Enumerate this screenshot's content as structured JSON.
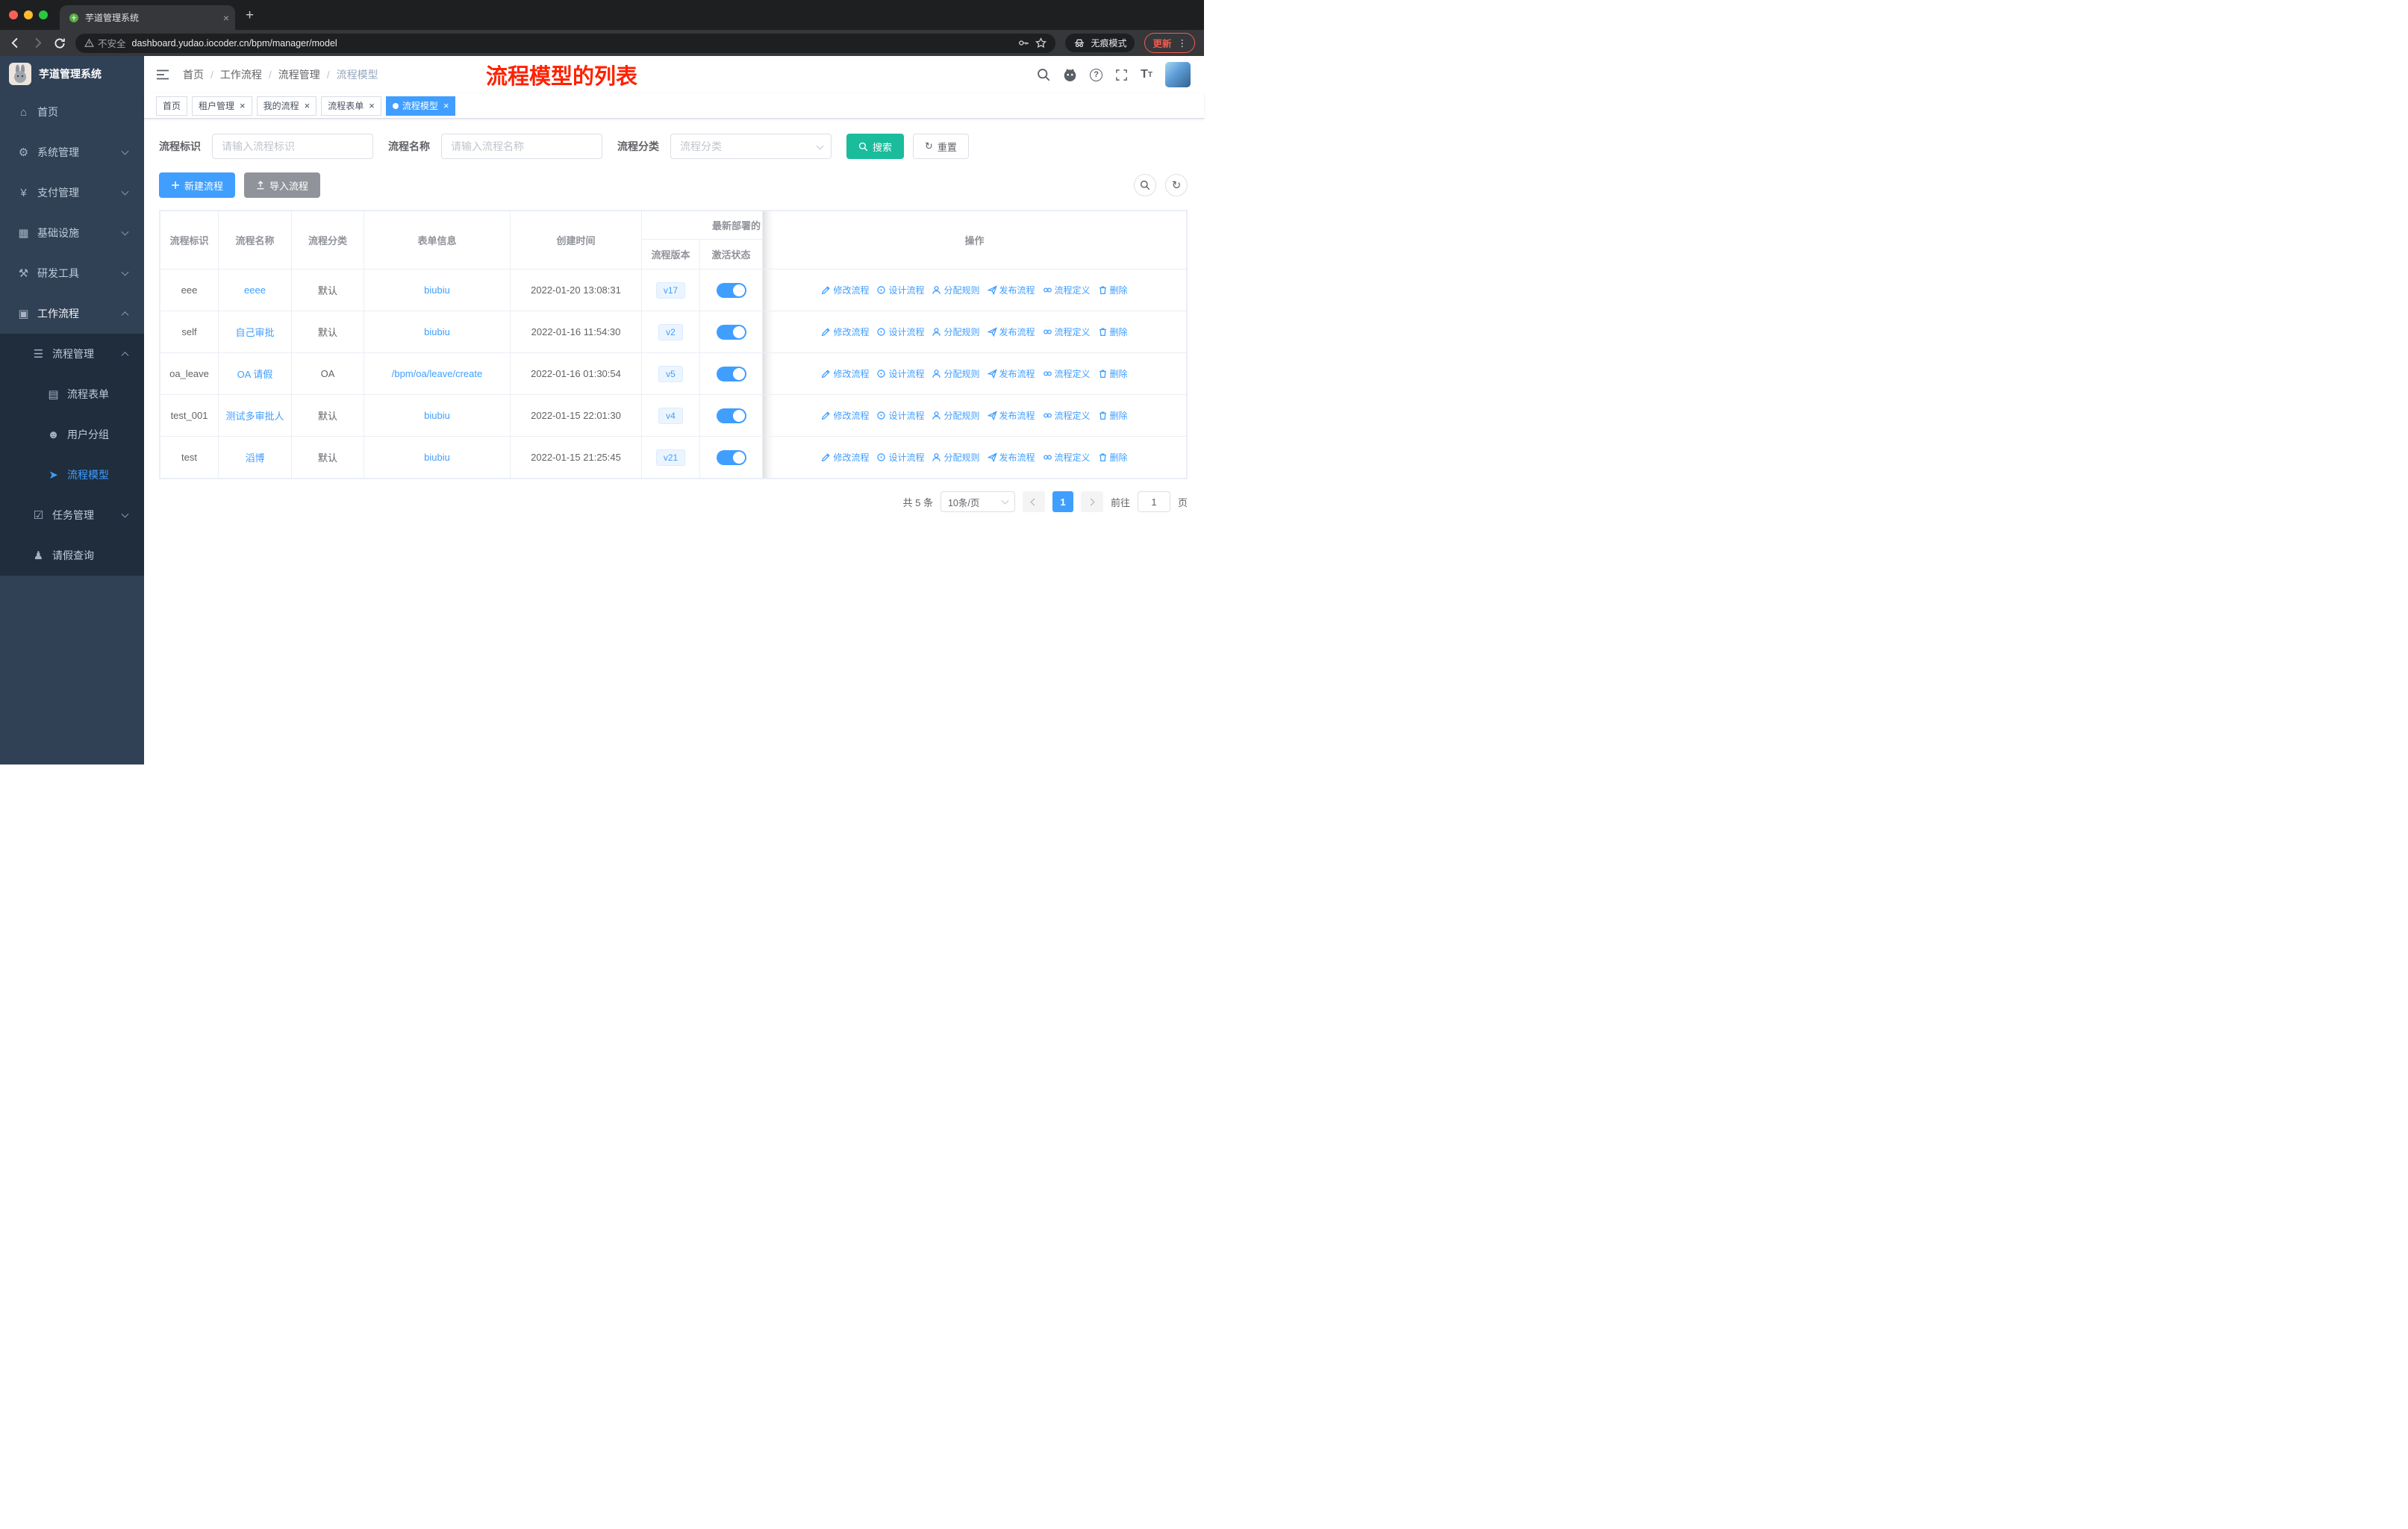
{
  "browser": {
    "tab_title": "芋道管理系统",
    "security": "不安全",
    "url": "dashboard.yudao.iocoder.cn/bpm/manager/model",
    "incognito": "无痕模式",
    "update": "更新"
  },
  "sidebar": {
    "title": "芋道管理系统",
    "menu": [
      {
        "label": "首页",
        "glyph": "⌂",
        "icon": "dashboard-icon",
        "cls": "lv1"
      },
      {
        "label": "系统管理",
        "glyph": "⚙",
        "icon": "system-management-icon",
        "cls": "lv1",
        "arrowcls": "down"
      },
      {
        "label": "支付管理",
        "glyph": "¥",
        "icon": "payment-management-icon",
        "cls": "lv1",
        "arrowcls": "down"
      },
      {
        "label": "基础设施",
        "glyph": "▦",
        "icon": "infrastructure-icon",
        "cls": "lv1",
        "arrowcls": "down"
      },
      {
        "label": "研发工具",
        "glyph": "⚒",
        "icon": "dev-tools-icon",
        "cls": "lv1",
        "arrowcls": "down"
      },
      {
        "label": "工作流程",
        "glyph": "▣",
        "icon": "workflow-icon",
        "cls": "lv1 open",
        "arrowcls": "up"
      },
      {
        "label": "流程管理",
        "glyph": "☰",
        "icon": "process-management-icon",
        "cls": "lv2",
        "arrowcls": "up"
      },
      {
        "label": "流程表单",
        "glyph": "▤",
        "icon": "process-form-icon",
        "cls": "lv3"
      },
      {
        "label": "用户分组",
        "glyph": "☻",
        "icon": "user-group-icon",
        "cls": "lv3"
      },
      {
        "label": "流程模型",
        "glyph": "➤",
        "icon": "process-model-icon",
        "cls": "lv3 active"
      },
      {
        "label": "任务管理",
        "glyph": "☑",
        "icon": "task-management-icon",
        "cls": "lv2",
        "arrowcls": "down"
      },
      {
        "label": "请假查询",
        "glyph": "♟",
        "icon": "leave-query-icon",
        "cls": "lv2"
      }
    ]
  },
  "header": {
    "breadcrumb": [
      "首页",
      "工作流程",
      "流程管理",
      "流程模型"
    ],
    "annotation": "流程模型的列表"
  },
  "tags": [
    {
      "label": "首页"
    },
    {
      "label": "租户管理",
      "closable": true
    },
    {
      "label": "我的流程",
      "closable": true
    },
    {
      "label": "流程表单",
      "closable": true
    },
    {
      "label": "流程模型",
      "closable": true,
      "active": true,
      "cls": "active"
    }
  ],
  "filters": {
    "id_label": "流程标识",
    "id_placeholder": "请输入流程标识",
    "name_label": "流程名称",
    "name_placeholder": "请输入流程名称",
    "category_label": "流程分类",
    "category_placeholder": "流程分类",
    "search_label": "搜索",
    "reset_label": "重置"
  },
  "toolbar": {
    "create_label": "新建流程",
    "import_label": "导入流程"
  },
  "table": {
    "headers": {
      "id": "流程标识",
      "name": "流程名称",
      "category": "流程分类",
      "form": "表单信息",
      "created": "创建时间",
      "deploy_group": "最新部署的",
      "version": "流程版本",
      "active": "激活状态",
      "actions": "操作"
    },
    "actions": [
      {
        "label": "修改流程",
        "icon": "edit-icon"
      },
      {
        "label": "设计流程",
        "icon": "design-icon"
      },
      {
        "label": "分配规则",
        "icon": "assign-rule-icon"
      },
      {
        "label": "发布流程",
        "icon": "publish-icon"
      },
      {
        "label": "流程定义",
        "icon": "definition-icon"
      },
      {
        "label": "删除",
        "icon": "delete-icon"
      }
    ],
    "rows": [
      {
        "id": "eee",
        "name": "eeee",
        "category": "默认",
        "form": "biubiu",
        "created": "2022-01-20 13:08:31",
        "version": "v17",
        "active": true
      },
      {
        "id": "self",
        "name": "自己审批",
        "category": "默认",
        "form": "biubiu",
        "created": "2022-01-16 11:54:30",
        "version": "v2",
        "active": true
      },
      {
        "id": "oa_leave",
        "name": "OA 请假",
        "category": "OA",
        "form": "/bpm/oa/leave/create",
        "created": "2022-01-16 01:30:54",
        "version": "v5",
        "active": true
      },
      {
        "id": "test_001",
        "name": "测试多审批人",
        "category": "默认",
        "form": "biubiu",
        "created": "2022-01-15 22:01:30",
        "version": "v4",
        "active": true
      },
      {
        "id": "test",
        "name": "滔博",
        "category": "默认",
        "form": "biubiu",
        "created": "2022-01-15 21:25:45",
        "version": "v21",
        "active": true
      }
    ]
  },
  "pagination": {
    "total": "共 5 条",
    "page_size": "10条/页",
    "page": "1",
    "goto": "前往",
    "goto_value": "1",
    "unit": "页"
  },
  "colors": {
    "primary": "#409eff",
    "search_button": "#1abc9c",
    "sidebar_bg": "#304156",
    "submenu_bg": "#1f2d3d",
    "annotation_red": "#ff2000",
    "version_badge_bg": "#ecf5ff"
  }
}
